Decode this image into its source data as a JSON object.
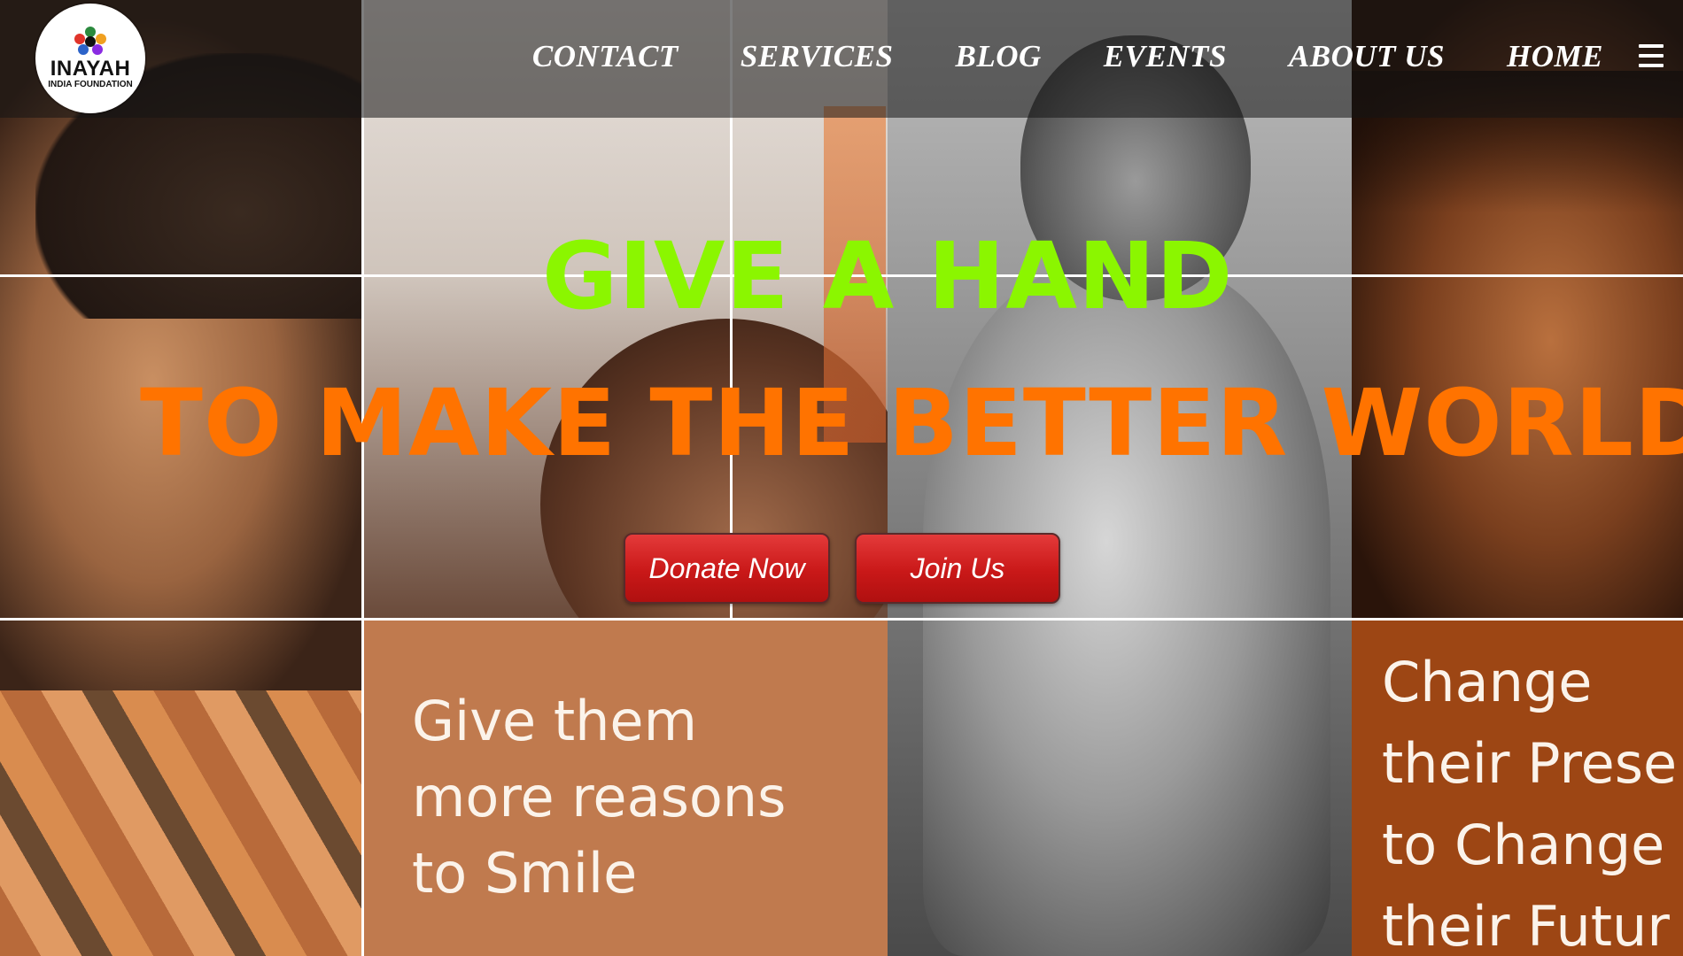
{
  "brand": {
    "name": "INAYAH",
    "tagline": "INDIA FOUNDATION"
  },
  "nav": {
    "items": [
      "CONTACT",
      "SERVICES",
      "BLOG",
      "EVENTS",
      "ABOUT US",
      "HOME"
    ],
    "menu_icon": "hamburger-menu-icon"
  },
  "hero": {
    "line1": "GIVE A HAND",
    "line2": "TO MAKE THE BETTER WORLD",
    "line1_color": "#8bf600",
    "line2_color": "#ff7300"
  },
  "buttons": {
    "donate": "Donate Now",
    "join": "Join Us",
    "color": "#c91818"
  },
  "collage": {
    "left_quote": [
      "Give them",
      "more reasons",
      "to Smile"
    ],
    "right_quote": [
      "Change",
      "their Prese",
      "to Change",
      "their Futur"
    ],
    "left_box_color": "#c07a4e",
    "right_box_color": "#9d4614"
  }
}
